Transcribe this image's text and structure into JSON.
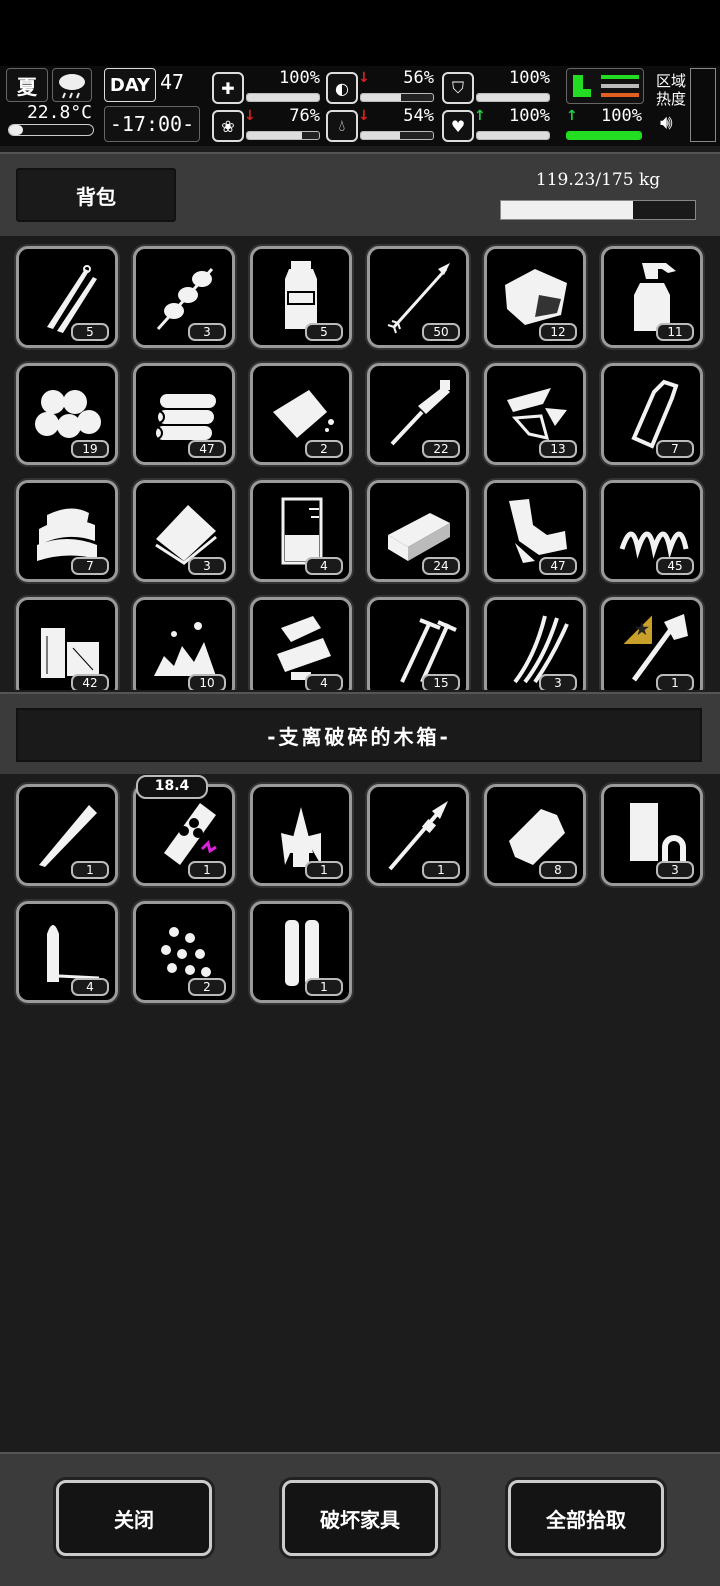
{
  "hud": {
    "season": "夏",
    "temperature": "22.8°C",
    "day_label": "DAY",
    "day": "47",
    "time": "-17:00-",
    "area_heat": "区域\n热度",
    "stats": [
      {
        "name": "health",
        "value": "100%",
        "level": 1.0,
        "trend": ""
      },
      {
        "name": "hunger",
        "value": "56%",
        "level": 0.56,
        "trend": "down"
      },
      {
        "name": "armor",
        "value": "100%",
        "level": 1.0,
        "trend": ""
      },
      {
        "name": "mental",
        "value": "76%",
        "level": 0.76,
        "trend": "down"
      },
      {
        "name": "thirst",
        "value": "54%",
        "level": 0.54,
        "trend": "down"
      },
      {
        "name": "heart",
        "value": "100%",
        "level": 1.0,
        "trend": "up"
      },
      {
        "name": "stamina",
        "value": "100%",
        "level": 1.0,
        "trend": "up"
      }
    ]
  },
  "backpack": {
    "title": "背包",
    "weight": "119.23/175 kg",
    "weight_fraction": 0.68,
    "items": [
      {
        "icon": "tweezers-icon",
        "count": "5"
      },
      {
        "icon": "kebab-icon",
        "count": "3"
      },
      {
        "icon": "water-bottle-icon",
        "count": "5"
      },
      {
        "icon": "arrow-icon",
        "count": "50"
      },
      {
        "icon": "meat-chunk-icon",
        "count": "12"
      },
      {
        "icon": "spray-bottle-icon",
        "count": "11"
      },
      {
        "icon": "cotton-balls-icon",
        "count": "19"
      },
      {
        "icon": "logs-icon",
        "count": "47"
      },
      {
        "icon": "bread-icon",
        "count": "2"
      },
      {
        "icon": "syringe-tool-icon",
        "count": "22"
      },
      {
        "icon": "glass-shards-icon",
        "count": "13"
      },
      {
        "icon": "glass-bottle-icon",
        "count": "7"
      },
      {
        "icon": "cloth-pile-icon",
        "count": "7"
      },
      {
        "icon": "towel-icon",
        "count": "3"
      },
      {
        "icon": "beaker-icon",
        "count": "4"
      },
      {
        "icon": "brick-icon",
        "count": "24"
      },
      {
        "icon": "scrap-metal-icon",
        "count": "47"
      },
      {
        "icon": "spring-icon",
        "count": "45"
      },
      {
        "icon": "wood-blocks-icon",
        "count": "42"
      },
      {
        "icon": "rubble-icon",
        "count": "10"
      },
      {
        "icon": "parts-icon",
        "count": "4"
      },
      {
        "icon": "nails-icon",
        "count": "15"
      },
      {
        "icon": "wires-icon",
        "count": "3"
      },
      {
        "icon": "axe-icon",
        "count": "1",
        "starred": true
      }
    ]
  },
  "container": {
    "title": "-支离破碎的木箱-",
    "items": [
      {
        "icon": "wooden-stake-icon",
        "count": "1"
      },
      {
        "icon": "pill-bottle-icon",
        "count": "1",
        "top_label": "18.4"
      },
      {
        "icon": "herbs-icon",
        "count": "1"
      },
      {
        "icon": "spear-icon",
        "count": "1"
      },
      {
        "icon": "paper-bag-icon",
        "count": "8"
      },
      {
        "icon": "tape-icon",
        "count": "3"
      },
      {
        "icon": "bullet-icon",
        "count": "4"
      },
      {
        "icon": "pellets-icon",
        "count": "2"
      },
      {
        "icon": "cartridges-icon",
        "count": "1"
      }
    ]
  },
  "buttons": {
    "close": "关闭",
    "destroy": "破坏家具",
    "take_all": "全部拾取"
  }
}
